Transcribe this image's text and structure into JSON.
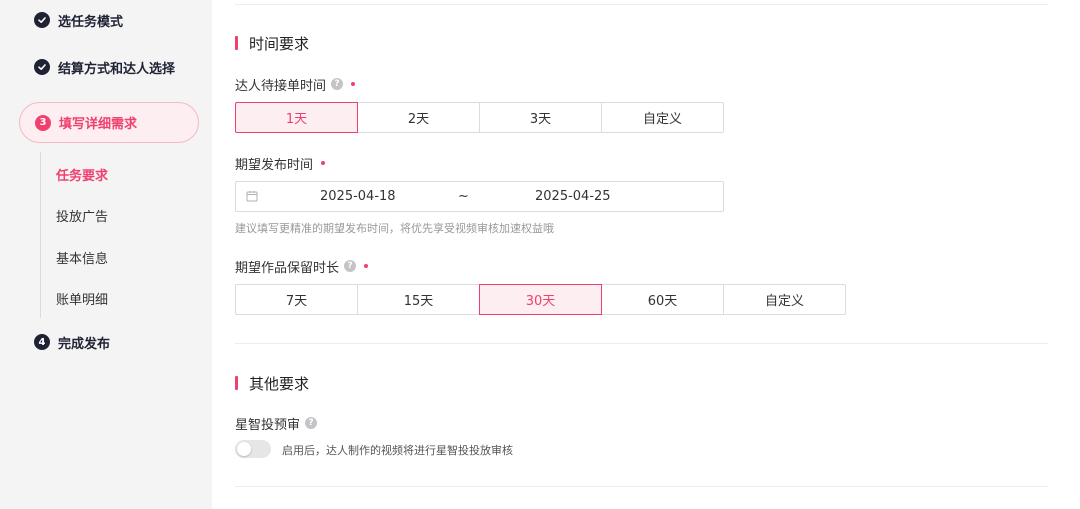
{
  "sidebar": {
    "steps": [
      {
        "label": "选任务模式"
      },
      {
        "label": "结算方式和达人选择"
      },
      {
        "num": "3",
        "label": "填写详细需求"
      },
      {
        "num": "4",
        "label": "完成发布"
      }
    ],
    "sub_items": [
      {
        "label": "任务要求"
      },
      {
        "label": "投放广告"
      },
      {
        "label": "基本信息"
      },
      {
        "label": "账单明细"
      }
    ]
  },
  "time_section": {
    "title": "时间要求",
    "wait_label": "达人待接单时间",
    "wait_options": [
      "1天",
      "2天",
      "3天",
      "自定义"
    ],
    "wait_selected": "1天",
    "publish_label": "期望发布时间",
    "start_date": "2025-04-18",
    "separator": "~",
    "end_date": "2025-04-25",
    "publish_hint": "建议填写更精准的期望发布时间，将优先享受视频审核加速权益哦",
    "retain_label": "期望作品保留时长",
    "retain_options": [
      "7天",
      "15天",
      "30天",
      "60天",
      "自定义"
    ],
    "retain_selected": "30天"
  },
  "other_section": {
    "title": "其他要求",
    "review_label": "星智投预审",
    "review_toggle_on": false,
    "review_toggle_text": "启用后，达人制作的视频将进行星智投投放审核"
  },
  "colors": {
    "accent": "#f0416e",
    "accent_bg": "#fdeef1",
    "sidebar_bg": "#f4f4f5",
    "dark": "#1f2233"
  },
  "icons": {
    "help": "?",
    "check": "check-icon",
    "calendar": "calendar-icon"
  }
}
